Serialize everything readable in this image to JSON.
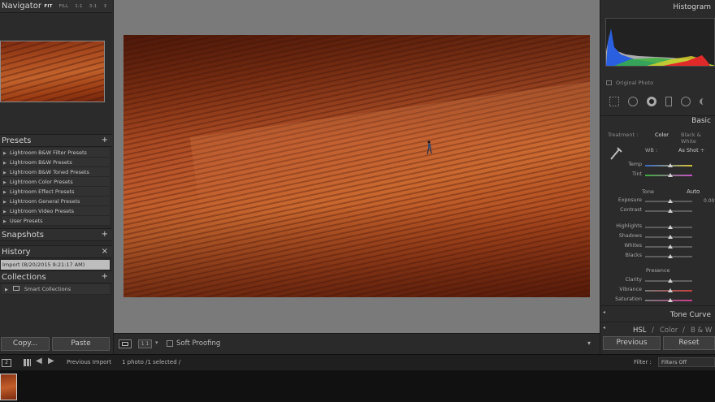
{
  "navigator": {
    "title": "Navigator",
    "fit": "FIT",
    "fill": "FILL",
    "r11": "1:1",
    "r31": "3:1",
    "arrow": "⇕"
  },
  "presets": {
    "title": "Presets",
    "items": [
      "Lightroom B&W Filter Presets",
      "Lightroom B&W Presets",
      "Lightroom B&W Toned Presets",
      "Lightroom Color Presets",
      "Lightroom Effect Presets",
      "Lightroom General Presets",
      "Lightroom Video Presets",
      "User Presets"
    ]
  },
  "snapshots": {
    "title": "Snapshots"
  },
  "history": {
    "title": "History",
    "item": "Import (8/20/2015 9:21:17 AM)",
    "close": "×"
  },
  "collections": {
    "title": "Collections",
    "smart": "Smart Collections"
  },
  "left_buttons": {
    "copy": "Copy...",
    "paste": "Paste"
  },
  "toolbar": {
    "soft_proofing": "Soft Proofing",
    "ratio": "1 1",
    "abc": "▾"
  },
  "histogram": {
    "title": "Histogram",
    "original": "Original Photo"
  },
  "basic": {
    "title": "Basic",
    "treatment": "Treatment :",
    "color": "Color",
    "bw": "Black & White",
    "wb": "WB :",
    "wb_value": "As Shot ÷",
    "tone": "Tone",
    "auto": "Auto",
    "exposure_value": "0.00",
    "presence": "Presence",
    "sliders": [
      {
        "label": "Temp"
      },
      {
        "label": "Tint"
      },
      {
        "label": "Exposure"
      },
      {
        "label": "Contrast"
      },
      {
        "label": "Highlights"
      },
      {
        "label": "Shadows"
      },
      {
        "label": "Whites"
      },
      {
        "label": "Blacks"
      },
      {
        "label": "Clarity"
      },
      {
        "label": "Vibrance"
      },
      {
        "label": "Saturation"
      }
    ]
  },
  "tone_curve": {
    "title": "Tone Curve"
  },
  "hsl": {
    "hsl": "HSL",
    "sep1": "/",
    "color": "Color",
    "sep2": "/",
    "bw": "B & W"
  },
  "right_buttons": {
    "previous": "Previous",
    "reset": "Reset"
  },
  "filmstrip": {
    "monitor1": "2",
    "prev_import": "Previous Import",
    "count": "1 photo /1 selected /",
    "filter": "Filter :",
    "filter_value": "Filters Off"
  },
  "icons": [
    "grid-icon",
    "back-arrow-icon",
    "forward-arrow-icon",
    "loupe-icon",
    "compare-icon"
  ]
}
